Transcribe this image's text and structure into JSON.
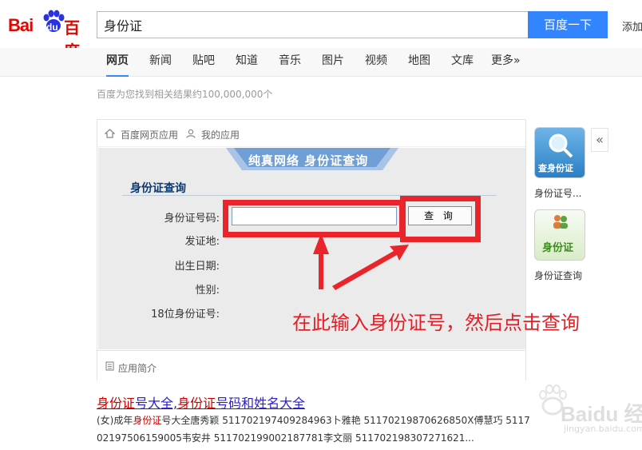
{
  "header": {
    "logo_latin": "Bai",
    "logo_du": "du",
    "logo_cn": "百度",
    "search_value": "身份证",
    "search_button": "百度一下",
    "add_link": "添加"
  },
  "nav": {
    "tabs": [
      "网页",
      "新闻",
      "贴吧",
      "知道",
      "音乐",
      "图片",
      "视频",
      "地图",
      "文库",
      "更多»"
    ],
    "active": "网页"
  },
  "result_count": "百度为您找到相关结果约100,000,000个",
  "app": {
    "top_links": [
      "百度网页应用",
      "我的应用"
    ],
    "banner": "纯真网络  身份证查询",
    "form_title": "身份证查询",
    "fields": [
      "身份证号码:",
      "发证地:",
      "出生日期:",
      "性别:",
      "18位身份证号:"
    ],
    "id_input_value": "",
    "query_button": "查 询",
    "footer": "应用简介"
  },
  "annotation": "在此输入身份证号，然后点击查询",
  "side": {
    "items": [
      {
        "icon_text": "查身份证",
        "label": "身份证号..."
      },
      {
        "icon_text": "身份证",
        "label": "身份证查询"
      }
    ],
    "collapse": "«"
  },
  "result": {
    "title_parts": [
      "身份证",
      "号大全,",
      "身份证",
      "号码和姓名大全"
    ],
    "snippet1_parts": [
      "(女)成年",
      "身份证",
      "号大全唐秀颖 511702197409284963卜雅艳 51170219870626850X傅慧巧 5117"
    ],
    "snippet2": "02197506159005韦安井 511702199002187781李文丽 511702198307271621..."
  },
  "watermark": {
    "brand": "Baidu 经验",
    "url": "jingyan.baidu.com"
  },
  "colors": {
    "brand_red": "#e10601",
    "button_blue": "#3385ff",
    "annotation_red": "#e9252b",
    "link_blue": "#2b1fc9"
  }
}
